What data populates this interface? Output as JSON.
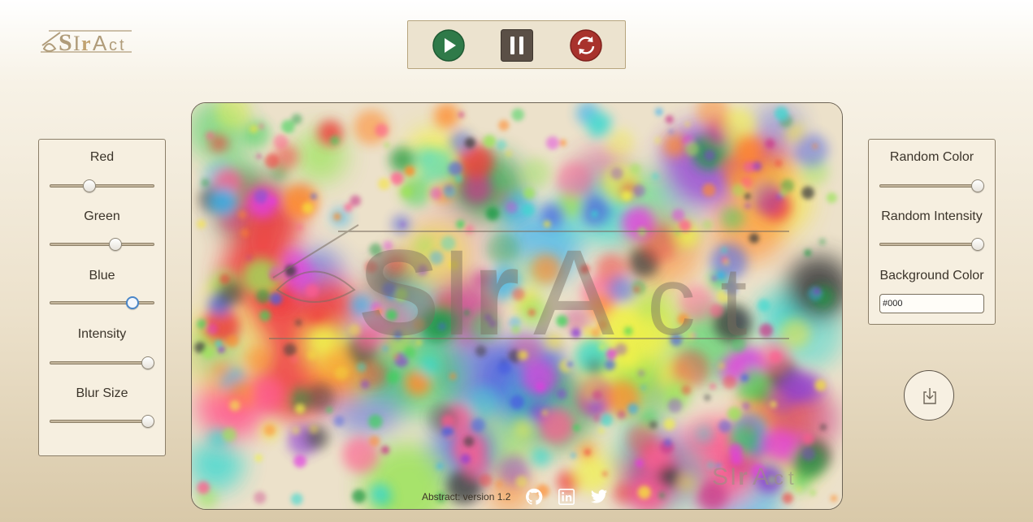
{
  "app": {
    "logo_text": "aSTrAct"
  },
  "controls": {
    "play_icon": "play-icon",
    "pause_icon": "pause-icon",
    "reset_icon": "refresh-icon",
    "play_color": "#2f7a49",
    "pause_color": "#5a4f46",
    "reset_color": "#a8322c"
  },
  "left_panel": {
    "sliders": [
      {
        "label": "Red",
        "value": 0.38
      },
      {
        "label": "Green",
        "value": 0.63
      },
      {
        "label": "Blue",
        "value": 0.79
      },
      {
        "label": "Intensity",
        "value": 0.94
      },
      {
        "label": "Blur Size",
        "value": 0.94
      }
    ]
  },
  "right_panel": {
    "sliders": [
      {
        "label": "Random Color",
        "value": 0.94
      },
      {
        "label": "Random Intensity",
        "value": 0.94
      }
    ],
    "background_color": {
      "label": "Background Color",
      "value": "#000"
    }
  },
  "download": {
    "icon": "download-icon"
  },
  "canvas": {
    "watermark": "aSTrAct",
    "corner_watermark": "aSTrAct"
  },
  "footer": {
    "version_text": "Abstract: version 1.2",
    "links": [
      {
        "icon": "github-icon"
      },
      {
        "icon": "linkedin-icon"
      },
      {
        "icon": "twitter-icon"
      }
    ]
  }
}
